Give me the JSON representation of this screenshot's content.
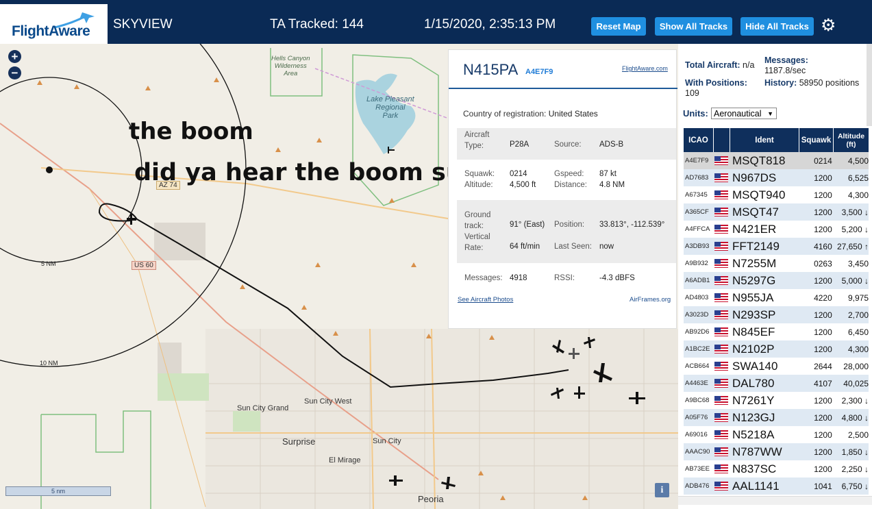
{
  "header": {
    "logo_flight": "Flight",
    "logo_aware": "Aware",
    "app_name": "SKYVIEW",
    "ta_tracked": "TA Tracked: 144",
    "datetime": "1/15/2020, 2:35:13 PM",
    "buttons": {
      "reset": "Reset Map",
      "show_all": "Show All Tracks",
      "hide_all": "Hide All Tracks"
    }
  },
  "map": {
    "zoom_in": "+",
    "zoom_out": "−",
    "meme_line1": "the boom",
    "meme_line2": "did ya hear the boom sucka",
    "labels": {
      "hells_canyon": "Hells Canyon\nWilderness\nArea",
      "lake_pleasant": "Lake Pleasant\nRegional\nPark",
      "az74": "AZ 74",
      "us60": "US 60",
      "sun_city_west": "Sun City West",
      "sun_city_grand": "Sun City Grand",
      "surprise": "Surprise",
      "sun_city": "Sun City",
      "el_mirage": "El Mirage",
      "peoria": "Peoria"
    },
    "ring_5": "5 NM",
    "ring_10": "10 NM",
    "scale": "5 nm",
    "info": "i"
  },
  "popup": {
    "ident": "N415PA",
    "hex": "A4E7F9",
    "link": "FlightAware.com",
    "country_label": "Country of registration:",
    "country": "United States",
    "aircraft_type_label": "Aircraft Type:",
    "aircraft_type": "P28A",
    "source_label": "Source:",
    "source": "ADS-B",
    "squawk_label": "Squawk:",
    "squawk": "0214",
    "gspeed_label": "Gspeed:",
    "gspeed": "87 kt",
    "altitude_label": "Altitude:",
    "altitude": "4,500 ft",
    "distance_label": "Distance:",
    "distance": "4.8 NM",
    "track_label": "Ground track:",
    "track": "91° (East)",
    "position_label": "Position:",
    "position": "33.813°, -112.539°",
    "vrate_label": "Vertical Rate:",
    "vrate": "64 ft/min",
    "lastseen_label": "Last Seen:",
    "lastseen": "now",
    "messages_label": "Messages:",
    "messages": "4918",
    "rssi_label": "RSSI:",
    "rssi": "-4.3 dBFS",
    "photos": "See Aircraft Photos",
    "airframes": "AirFrames.org"
  },
  "panel": {
    "total_label": "Total Aircraft:",
    "total": "n/a",
    "messages_label": "Messages:",
    "messages": "1187.8/sec",
    "withpos_label": "With Positions:",
    "withpos": "109",
    "history_label": "History:",
    "history": "58950 positions",
    "units_label": "Units:",
    "units": "Aeronautical",
    "columns": [
      "ICAO",
      "",
      "Ident",
      "Squawk",
      "Altitude (ft)"
    ],
    "rows": [
      {
        "icao": "A4E7F9",
        "ident": "MSQT818",
        "squawk": "0214",
        "alt": "4,500"
      },
      {
        "icao": "AD7683",
        "ident": "N967DS",
        "squawk": "1200",
        "alt": "6,525"
      },
      {
        "icao": "A67345",
        "ident": "MSQT940",
        "squawk": "1200",
        "alt": "4,300"
      },
      {
        "icao": "A365CF",
        "ident": "MSQT47",
        "squawk": "1200",
        "alt": "3,500 ↓"
      },
      {
        "icao": "A4FFCA",
        "ident": "N421ER",
        "squawk": "1200",
        "alt": "5,200 ↓"
      },
      {
        "icao": "A3DB93",
        "ident": "FFT2149",
        "squawk": "4160",
        "alt": "27,650 ↑"
      },
      {
        "icao": "A9B932",
        "ident": "N7255M",
        "squawk": "0263",
        "alt": "3,450"
      },
      {
        "icao": "A6ADB1",
        "ident": "N5297G",
        "squawk": "1200",
        "alt": "5,000 ↓"
      },
      {
        "icao": "AD4803",
        "ident": "N955JA",
        "squawk": "4220",
        "alt": "9,975"
      },
      {
        "icao": "A3023D",
        "ident": "N293SP",
        "squawk": "1200",
        "alt": "2,700"
      },
      {
        "icao": "AB92D6",
        "ident": "N845EF",
        "squawk": "1200",
        "alt": "6,450"
      },
      {
        "icao": "A1BC2E",
        "ident": "N2102P",
        "squawk": "1200",
        "alt": "4,300"
      },
      {
        "icao": "ACB664",
        "ident": "SWA140",
        "squawk": "2644",
        "alt": "28,000"
      },
      {
        "icao": "A4463E",
        "ident": "DAL780",
        "squawk": "4107",
        "alt": "40,025"
      },
      {
        "icao": "A9BC68",
        "ident": "N7261Y",
        "squawk": "1200",
        "alt": "2,300 ↓"
      },
      {
        "icao": "A05F76",
        "ident": "N123GJ",
        "squawk": "1200",
        "alt": "4,800 ↓"
      },
      {
        "icao": "A69016",
        "ident": "N5218A",
        "squawk": "1200",
        "alt": "2,500"
      },
      {
        "icao": "AAAC90",
        "ident": "N787WW",
        "squawk": "1200",
        "alt": "1,850 ↓"
      },
      {
        "icao": "AB73EE",
        "ident": "N837SC",
        "squawk": "1200",
        "alt": "2,250 ↓"
      },
      {
        "icao": "ADB476",
        "ident": "AAL1141",
        "squawk": "1041",
        "alt": "6,750 ↓"
      }
    ]
  },
  "colors": {
    "header_bg": "#0a2a55",
    "button_bg": "#1f8fe0",
    "table_header": "#0f2f5c",
    "row_alt": "#dfe9f3"
  }
}
